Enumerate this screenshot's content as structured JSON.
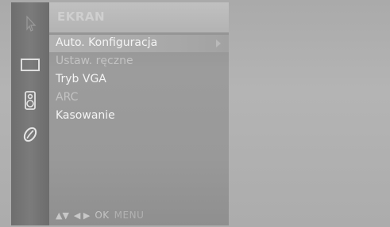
{
  "sidebar": {
    "icons": [
      {
        "name": "picture-icon"
      },
      {
        "name": "screen-icon"
      },
      {
        "name": "speaker-icon"
      },
      {
        "name": "option-icon"
      }
    ]
  },
  "menu": {
    "title": "EKRAN",
    "items": [
      {
        "label": "Auto. Konfiguracja",
        "selected": true
      },
      {
        "label": "Ustaw. ręczne",
        "dim": true
      },
      {
        "label": "Tryb VGA"
      },
      {
        "label": "ARC",
        "dim": true
      },
      {
        "label": "Kasowanie"
      }
    ]
  },
  "footer": {
    "nav_glyph": "▲▼",
    "side_glyph": "◀ ▶",
    "ok_label": "OK",
    "menu_label": "MENU"
  }
}
